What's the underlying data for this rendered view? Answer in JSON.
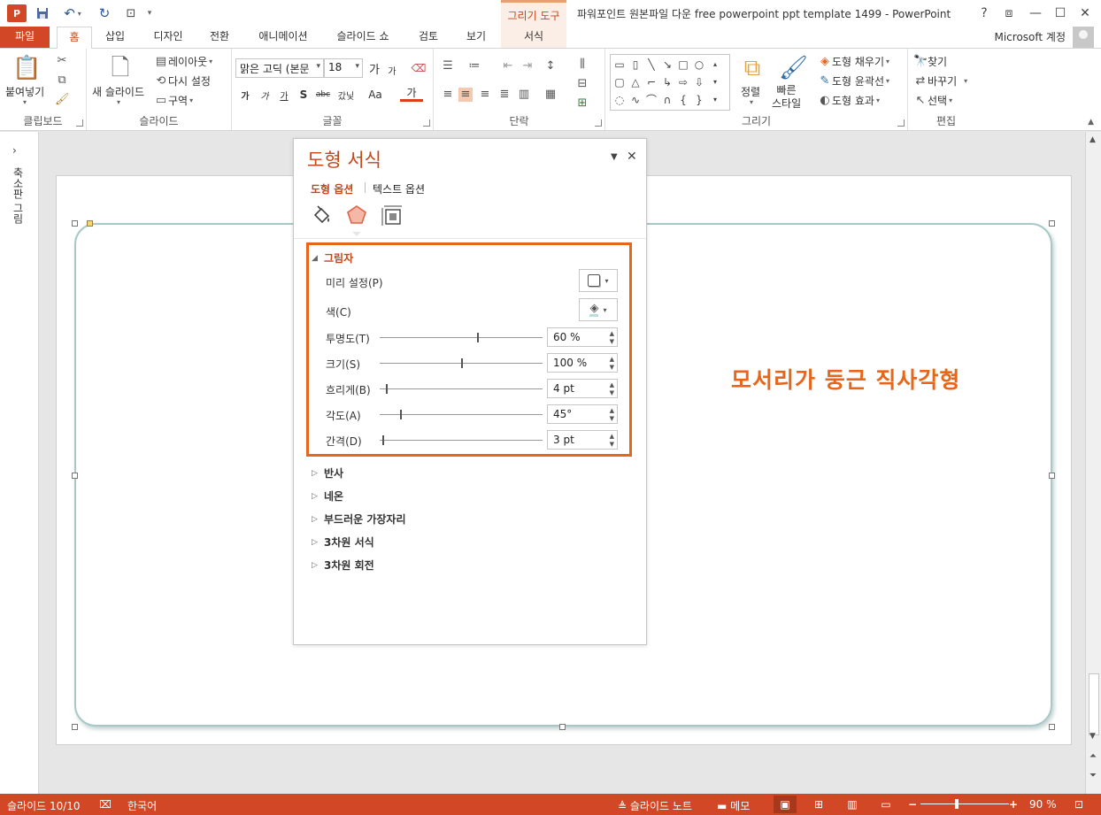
{
  "titlebar": {
    "window_title": "파워포인트 원본파일 다운 free powerpoint ppt template 1499 - PowerPoint",
    "context_tool": "그리기 도구",
    "help": "?",
    "restore_ribbon": "⧈",
    "minimize": "—",
    "maximize": "☐",
    "close": "✕"
  },
  "tabs": {
    "file": "파일",
    "home": "홈",
    "insert": "삽입",
    "design": "디자인",
    "transitions": "전환",
    "animations": "애니메이션",
    "slideshow": "슬라이드 쇼",
    "review": "검토",
    "view": "보기",
    "format": "서식",
    "account": "Microsoft 계정"
  },
  "ribbon": {
    "clipboard": {
      "label": "클립보드",
      "paste": "붙여넣기"
    },
    "slides": {
      "label": "슬라이드",
      "new_slide": "새 슬라이드",
      "layout": "레이아웃",
      "reset": "다시 설정",
      "section": "구역"
    },
    "font": {
      "label": "글꼴",
      "font_name": "맑은 고딕 (본문",
      "font_size": "18",
      "grow": "가",
      "shrink": "가",
      "bold": "가",
      "italic": "가",
      "underline": "가",
      "shadow": "S",
      "strike": "abc",
      "spacing": "갔닟",
      "case": "Aa",
      "color": "가"
    },
    "paragraph": {
      "label": "단락"
    },
    "drawing": {
      "label": "그리기",
      "arrange": "정렬",
      "quick_styles": "빠른\n스타일",
      "fill": "도형 채우기",
      "outline": "도형 윤곽선",
      "effects": "도형 효과"
    },
    "editing": {
      "label": "편집",
      "find": "찾기",
      "replace": "바꾸기",
      "select": "선택"
    }
  },
  "left_pane": {
    "label": "축소판 그림"
  },
  "slide": {
    "text": "모서리가 둥근 직사각형"
  },
  "format_pane": {
    "title": "도형 서식",
    "tab_shape": "도형 옵션",
    "tab_text": "텍스트 옵션",
    "shadow": {
      "heading": "그림자",
      "preset": "미리 설정(P)",
      "color": "색(C)",
      "transparency_label": "투명도(T)",
      "transparency_value": "60 %",
      "transparency_level": 0.6,
      "size_label": "크기(S)",
      "size_value": "100 %",
      "size_level": 0.5,
      "blur_label": "흐리게(B)",
      "blur_value": "4 pt",
      "blur_level": 0.04,
      "angle_label": "각도(A)",
      "angle_value": "45°",
      "angle_level": 0.125,
      "distance_label": "간격(D)",
      "distance_value": "3 pt",
      "distance_level": 0.015
    },
    "sections": [
      "반사",
      "네온",
      "부드러운 가장자리",
      "3차원 서식",
      "3차원 회전"
    ]
  },
  "statusbar": {
    "slide_count": "슬라이드 10/10",
    "language": "한국어",
    "notes": "슬라이드 노트",
    "comments": "메모",
    "zoom": "90 %",
    "zoom_level": 0.9
  },
  "colors": {
    "accent": "#d24726",
    "highlight": "#e8661b",
    "pane_title": "#c24719"
  }
}
